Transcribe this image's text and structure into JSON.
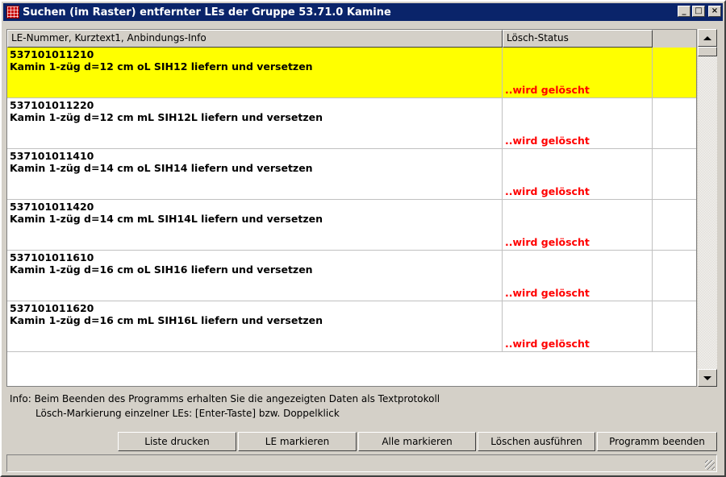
{
  "window": {
    "title": "Suchen (im Raster) entfernter LEs der Gruppe 53.71.0  Kamine",
    "minimize_label": "_",
    "maximize_label": "□",
    "close_label": "×"
  },
  "list": {
    "columns": [
      "LE-Nummer, Kurztext1, Anbindungs-Info",
      "Lösch-Status"
    ],
    "rows": [
      {
        "number": "537101011210",
        "text": "Kamin 1-züg d=12 cm oL SIH12 liefern und versetzen",
        "status": "..wird gelöscht",
        "selected": true
      },
      {
        "number": "537101011220",
        "text": "Kamin 1-züg d=12 cm mL SIH12L liefern und versetzen",
        "status": "..wird gelöscht",
        "selected": false
      },
      {
        "number": "537101011410",
        "text": "Kamin 1-züg d=14 cm oL SIH14 liefern und versetzen",
        "status": "..wird gelöscht",
        "selected": false
      },
      {
        "number": "537101011420",
        "text": "Kamin 1-züg d=14 cm mL SIH14L liefern und versetzen",
        "status": "..wird gelöscht",
        "selected": false
      },
      {
        "number": "537101011610",
        "text": "Kamin 1-züg d=16 cm oL SIH16 liefern und versetzen",
        "status": "..wird gelöscht",
        "selected": false
      },
      {
        "number": "537101011620",
        "text": "Kamin 1-züg d=16 cm mL SIH16L liefern und versetzen",
        "status": "..wird gelöscht",
        "selected": false
      }
    ],
    "selected_color": "#ffff00",
    "status_color": "#ff0000"
  },
  "info": {
    "line1": "Info: Beim Beenden des Programms erhalten Sie die angezeigten Daten als Textprotokoll",
    "line2": "Lösch-Markierung einzelner LEs: [Enter-Taste] bzw. Doppelklick"
  },
  "buttons": {
    "print": "Liste drucken",
    "mark": "LE markieren",
    "mark_all": "Alle markieren",
    "delete": "Löschen ausführen",
    "exit": "Programm beenden"
  },
  "statusbar": {
    "text": ""
  }
}
